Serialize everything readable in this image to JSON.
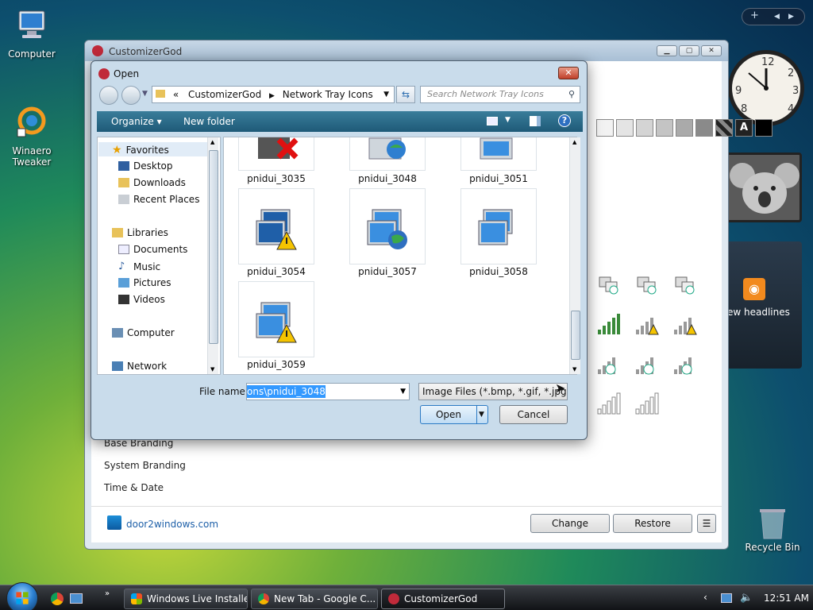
{
  "desktop": {
    "icons": [
      {
        "label": "Computer",
        "icon": "computer-icon"
      },
      {
        "label": "Winaero\nTweaker",
        "icon": "winaero-tweaker-icon"
      },
      {
        "label": "Recycle Bin",
        "icon": "recycle-bin-icon"
      }
    ]
  },
  "gadgets": {
    "clock": {
      "hour": 12,
      "minute": 51
    },
    "feed_text": "ew headlines"
  },
  "main_window": {
    "title": "CustomizerGod",
    "side_links": [
      "Base Branding",
      "System Branding",
      "Time & Date"
    ],
    "footer_link": "door2windows.com",
    "buttons": {
      "change": "Change",
      "restore": "Restore",
      "menu": "☰"
    }
  },
  "dialog": {
    "title": "Open",
    "close_label": "✕",
    "breadcrumb": {
      "prefix": "«",
      "parts": [
        "CustomizerGod",
        "Network Tray Icons"
      ]
    },
    "search_placeholder": "Search Network Tray Icons",
    "toolbar": {
      "organize": "Organize ▾",
      "new_folder": "New folder"
    },
    "nav": {
      "favorites": "Favorites",
      "desktop": "Desktop",
      "downloads": "Downloads",
      "recent_places": "Recent Places",
      "libraries": "Libraries",
      "documents": "Documents",
      "music": "Music",
      "pictures": "Pictures",
      "videos": "Videos",
      "computer": "Computer",
      "network": "Network"
    },
    "files": [
      {
        "name": "pnidui_3035",
        "badge": "error"
      },
      {
        "name": "pnidui_3048",
        "badge": "globe"
      },
      {
        "name": "pnidui_3051",
        "badge": "none"
      },
      {
        "name": "pnidui_3054",
        "badge": "warning"
      },
      {
        "name": "pnidui_3057",
        "badge": "globe"
      },
      {
        "name": "pnidui_3058",
        "badge": "none"
      },
      {
        "name": "pnidui_3059",
        "badge": "warning"
      }
    ],
    "file_name_label": "File name:",
    "file_name_value": "ons\\pnidui_3048",
    "file_type_value": "Image Files (*.bmp, *.gif, *.jpg,",
    "open_button": "Open",
    "cancel_button": "Cancel"
  },
  "taskbar": {
    "tasks": [
      {
        "label": "Windows Live Installer"
      },
      {
        "label": "New Tab - Google C..."
      },
      {
        "label": "CustomizerGod"
      }
    ],
    "time": "12:51 AM"
  },
  "colors": {
    "accent": "#1e5a78",
    "selection": "#3399ff"
  }
}
